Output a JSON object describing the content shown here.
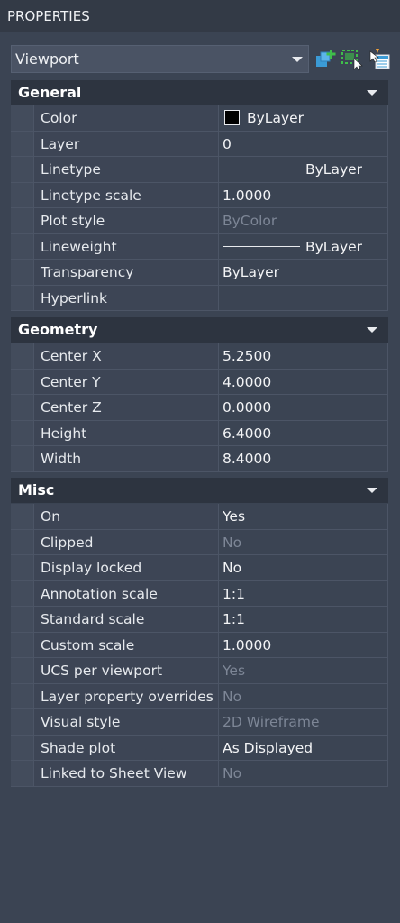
{
  "panel_title": "PROPERTIES",
  "selector": {
    "value": "Viewport"
  },
  "toolbar": {
    "icons": [
      "toggle-pickadd-icon",
      "select-objects-icon",
      "quick-select-icon"
    ]
  },
  "sections": {
    "general": {
      "title": "General",
      "rows": [
        {
          "name": "Color",
          "value": "ByLayer"
        },
        {
          "name": "Layer",
          "value": "0"
        },
        {
          "name": "Linetype",
          "value": "ByLayer"
        },
        {
          "name": "Linetype scale",
          "value": "1.0000"
        },
        {
          "name": "Plot style",
          "value": "ByColor"
        },
        {
          "name": "Lineweight",
          "value": "ByLayer"
        },
        {
          "name": "Transparency",
          "value": "ByLayer"
        },
        {
          "name": "Hyperlink",
          "value": ""
        }
      ]
    },
    "geometry": {
      "title": "Geometry",
      "rows": [
        {
          "name": "Center X",
          "value": "5.2500"
        },
        {
          "name": "Center Y",
          "value": "4.0000"
        },
        {
          "name": "Center Z",
          "value": "0.0000"
        },
        {
          "name": "Height",
          "value": "6.4000"
        },
        {
          "name": "Width",
          "value": "8.4000"
        }
      ]
    },
    "misc": {
      "title": "Misc",
      "rows": [
        {
          "name": "On",
          "value": "Yes"
        },
        {
          "name": "Clipped",
          "value": "No"
        },
        {
          "name": "Display locked",
          "value": "No"
        },
        {
          "name": "Annotation scale",
          "value": "1:1"
        },
        {
          "name": "Standard scale",
          "value": "1:1"
        },
        {
          "name": "Custom scale",
          "value": "1.0000"
        },
        {
          "name": "UCS per viewport",
          "value": "Yes"
        },
        {
          "name": "Layer property overrides",
          "value": "No"
        },
        {
          "name": "Visual style",
          "value": "2D Wireframe"
        },
        {
          "name": "Shade plot",
          "value": "As Displayed"
        },
        {
          "name": "Linked to Sheet View",
          "value": "No"
        }
      ]
    }
  },
  "colors": {
    "panel_bg": "#3b4453",
    "header_bg": "#2d3440",
    "text": "#f3f4f6",
    "dim_text": "#7d8696",
    "accent_blue": "#3b9bd6",
    "accent_green": "#3fbf4a"
  }
}
